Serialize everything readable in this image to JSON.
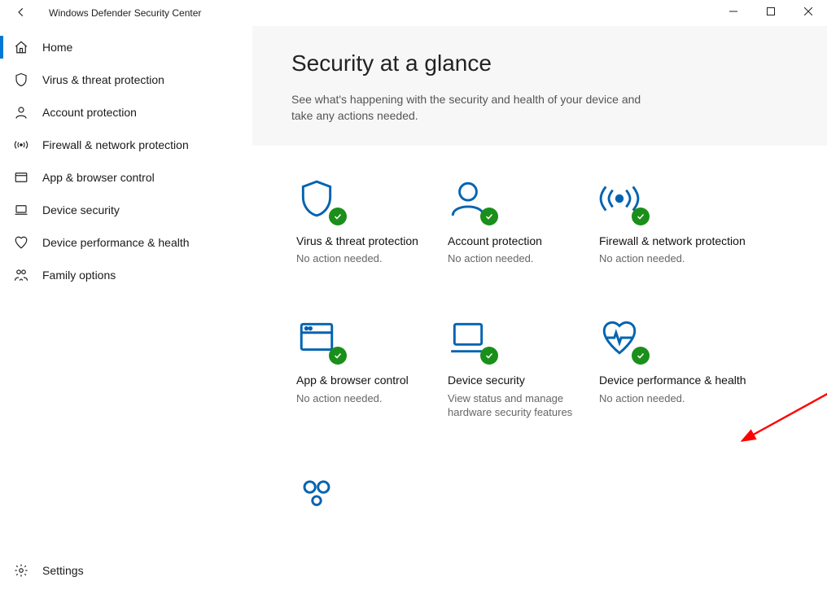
{
  "window": {
    "title": "Windows Defender Security Center"
  },
  "sidebar": {
    "items": [
      {
        "label": "Home",
        "icon": "home"
      },
      {
        "label": "Virus & threat protection",
        "icon": "shield"
      },
      {
        "label": "Account protection",
        "icon": "person"
      },
      {
        "label": "Firewall & network protection",
        "icon": "antenna"
      },
      {
        "label": "App & browser control",
        "icon": "browser"
      },
      {
        "label": "Device security",
        "icon": "laptop"
      },
      {
        "label": "Device performance & health",
        "icon": "heart"
      },
      {
        "label": "Family options",
        "icon": "family"
      }
    ],
    "settings_label": "Settings"
  },
  "main": {
    "heading": "Security at a glance",
    "subheading": "See what's happening with the security and health of your device and take any actions needed."
  },
  "tiles": [
    {
      "title": "Virus & threat protection",
      "status": "No action needed.",
      "icon": "shield"
    },
    {
      "title": "Account protection",
      "status": "No action needed.",
      "icon": "person"
    },
    {
      "title": "Firewall & network protection",
      "status": "No action needed.",
      "icon": "antenna"
    },
    {
      "title": "App & browser control",
      "status": "No action needed.",
      "icon": "browser"
    },
    {
      "title": "Device security",
      "status": "View status and manage hardware security features",
      "icon": "laptop"
    },
    {
      "title": "Device performance & health",
      "status": "No action needed.",
      "icon": "heart"
    }
  ]
}
